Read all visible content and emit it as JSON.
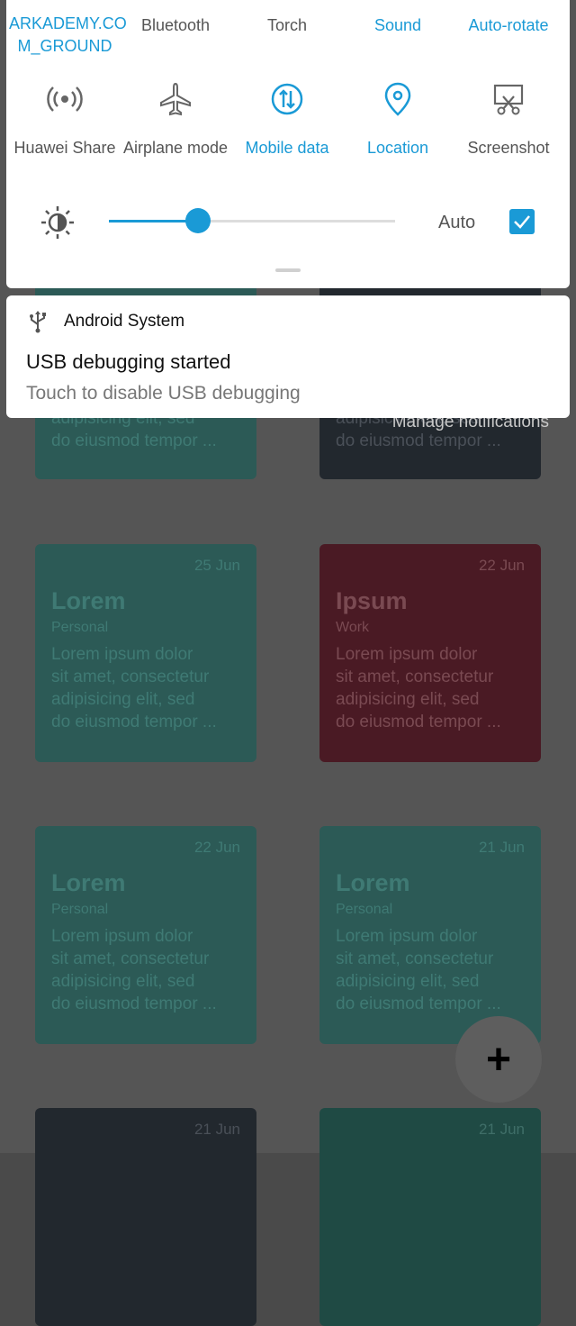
{
  "quick_settings": {
    "top_row": [
      {
        "label": "ARKADEMY.CO\nM_GROUND",
        "active": true
      },
      {
        "label": "Bluetooth",
        "active": false
      },
      {
        "label": "Torch",
        "active": false
      },
      {
        "label": "Sound",
        "active": true
      },
      {
        "label": "Auto-rotate",
        "active": true
      }
    ],
    "tiles": [
      {
        "label": "Huawei Share",
        "icon": "huawei-share-icon",
        "active": false
      },
      {
        "label": "Airplane mode",
        "icon": "airplane-icon",
        "active": false
      },
      {
        "label": "Mobile data",
        "icon": "mobile-data-icon",
        "active": true
      },
      {
        "label": "Location",
        "icon": "location-icon",
        "active": true
      },
      {
        "label": "Screenshot",
        "icon": "screenshot-icon",
        "active": false
      }
    ],
    "brightness": {
      "level": 0.31,
      "auto_label": "Auto",
      "auto_checked": true
    },
    "accent_color": "#1a9ad6"
  },
  "notification": {
    "app_name": "Android System",
    "title": "USB debugging started",
    "text": "Touch to disable USB debugging"
  },
  "manage_notifications": "Manage notifications",
  "notes": [
    {
      "date": "",
      "title": "",
      "category": "",
      "body": "adipisicing elit, sed\ndo eiusmod tempor ..."
    },
    {
      "date": "",
      "title": "",
      "category": "",
      "body": "adipisicing elit, sed\ndo eiusmod tempor ..."
    },
    {
      "date": "25 Jun",
      "title": "Lorem",
      "category": "Personal",
      "body": "Lorem ipsum dolor\nsit amet, consectetur\nadipisicing elit, sed\ndo eiusmod tempor ..."
    },
    {
      "date": "22 Jun",
      "title": "Ipsum",
      "category": "Work",
      "body": "Lorem ipsum dolor\nsit amet, consectetur\nadipisicing elit, sed\ndo eiusmod tempor ..."
    },
    {
      "date": "22 Jun",
      "title": "Lorem",
      "category": "Personal",
      "body": "Lorem ipsum dolor\nsit amet, consectetur\nadipisicing elit, sed\ndo eiusmod tempor ..."
    },
    {
      "date": "21 Jun",
      "title": "Lorem",
      "category": "Personal",
      "body": "Lorem ipsum dolor\nsit amet, consectetur\nadipisicing elit, sed\ndo eiusmod tempor ..."
    },
    {
      "date": "21 Jun",
      "title": "",
      "category": "",
      "body": ""
    },
    {
      "date": "21 Jun",
      "title": "",
      "category": "",
      "body": ""
    }
  ],
  "fab_label": "+"
}
